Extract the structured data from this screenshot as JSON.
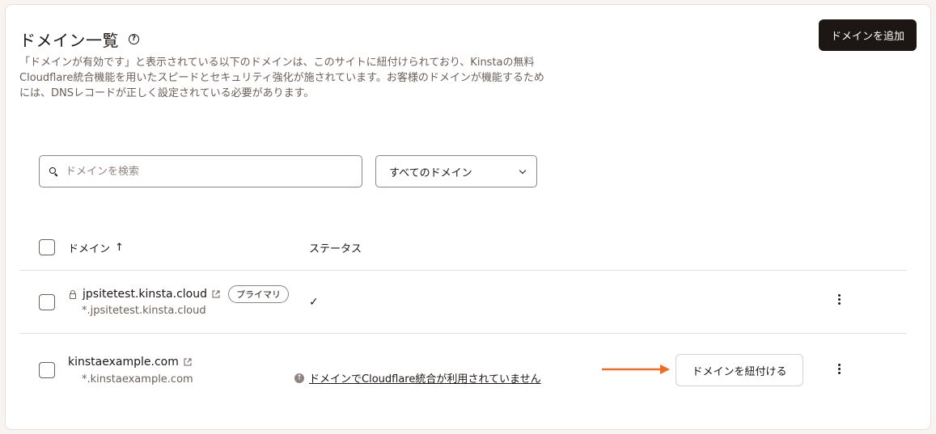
{
  "header": {
    "title": "ドメイン一覧",
    "help_icon": "?",
    "description": "「ドメインが有効です」と表示されている以下のドメインは、このサイトに紐付けられており、Kinstaの無料Cloudflare統合機能を用いたスピードとセキュリティ強化が施されています。お客様のドメインが機能するためには、DNSレコードが正しく設定されている必要があります。",
    "add_button": "ドメインを追加"
  },
  "filters": {
    "search_placeholder": "ドメインを検索",
    "select_value": "すべてのドメイン"
  },
  "table": {
    "col_domain": "ドメイン",
    "sort_indicator": "↑",
    "col_status": "ステータス",
    "rows": [
      {
        "domain": "jpsitetest.kinsta.cloud",
        "wildcard": "*.jpsitetest.kinsta.cloud",
        "badge": "プライマリ",
        "status_icon": "✓"
      },
      {
        "domain": "kinstaexample.com",
        "wildcard": "*.kinstaexample.com",
        "status_text": "ドメインでCloudflare統合が利用されていません",
        "action_button": "ドメインを紐付ける"
      }
    ]
  },
  "colors": {
    "primary_button": "#1c1614",
    "annotation_arrow": "#f26b21"
  }
}
